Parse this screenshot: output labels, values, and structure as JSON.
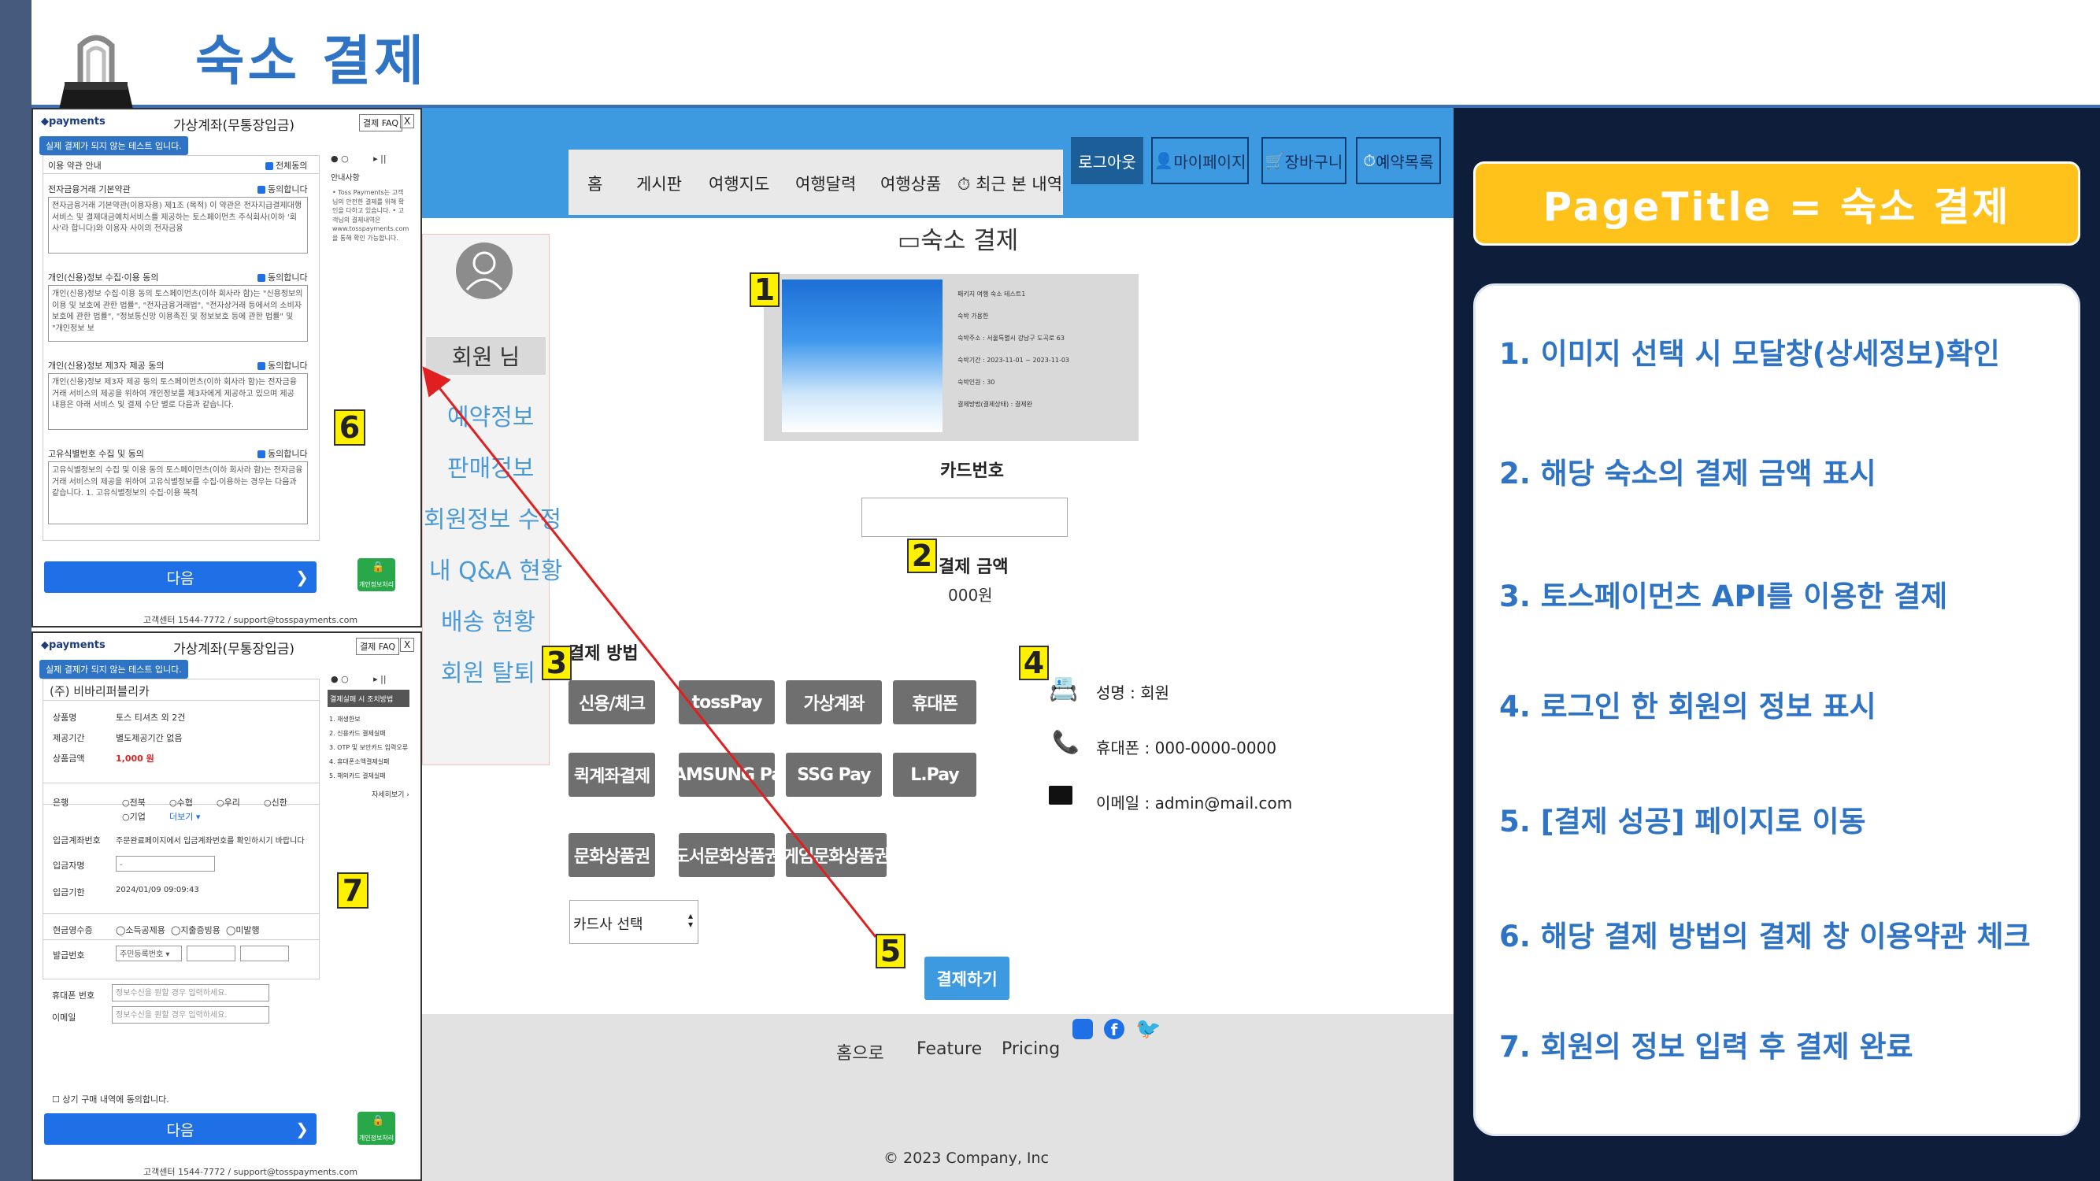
{
  "page_title": "숙소 결제",
  "right_panel": {
    "page_title_label": "PageTitle = 숙소 결제",
    "descriptions": [
      "1. 이미지 선택 시 모달창(상세정보)확인",
      "2. 해당 숙소의 결제 금액 표시",
      "3. 토스페이먼츠 API를 이용한 결제",
      "4. 로그인 한 회원의 정보 표시",
      "5. [결제 성공] 페이지로 이동",
      "6. 해당 결제 방법의 결제 창 이용약관 체크",
      "7. 회원의 정보 입력 후 결제 완료"
    ]
  },
  "popup_top": {
    "logo": "payments",
    "title": "가상계좌(무통장입금)",
    "faq": "결제 FAQ",
    "close": "X",
    "test_notice": "실제 결제가 되지 않는 테스트 입니다.",
    "terms_header": "이용 약관 안내",
    "agree_all": "전체동의",
    "agree": "동의합니다",
    "terms": [
      {
        "title": "전자금융거래 기본약관",
        "text": "전자금융거래 기본약관(이용자용) 제1조 (목적) 이 약관은 전자지급결제대행서비스 및 결제대금예치서비스를 제공하는 토스페이먼츠 주식회사(이하 '회사'라 합니다)와 이용자 사이의 전자금융"
      },
      {
        "title": "개인(신용)정보 수집·이용 동의",
        "text": "개인(신용)정보 수집·이용 동의 토스페이먼츠(이하 회사라 함)는 \"신용정보의 이용 및 보호에 관한 법률\", \"전자금융거래법\", \"전자상거래 등에서의 소비자보호에 관한 법률\", \"정보통신망 이용촉진 및 정보보호 등에 관한 법률\" 및 \"개인정보 보"
      },
      {
        "title": "개인(신용)정보 제3자 제공 동의",
        "text": "개인(신용)정보 제3자 제공 동의 토스페이먼츠(이하 회사라 함)는 전자금융거래 서비스의 제공을 위하여 개인정보를 제3자에게 제공하고 있으며 제공 내용은 아래 서비스 및 결제 수단 별로 다음과 같습니다."
      },
      {
        "title": "고유식별번호 수집 및 동의",
        "text": "고유식별정보의 수집 및 이용 동의 토스페이먼츠(이하 회사라 함)는 전자금융거래 서비스의 제공을 위하여 고유식별정보를 수집·이용하는 경우는 다음과 같습니다. 1. 고유식별정보의 수집·이용 목적"
      }
    ],
    "side_title": "안내사항",
    "side_text": "• Toss Payments는 고객님의 안전한 결제를 위해 확인을 다하고 있습니다. • 고객님의 결제내역은 www.tosspayments.com을 통해 확인 가능합니다.",
    "next": "다음",
    "green_label": "개인정보처리",
    "footer": "고객센터 1544-7772 / support@tosspayments.com"
  },
  "popup_bottom": {
    "logo": "payments",
    "title": "가상계좌(무통장입금)",
    "faq": "결제 FAQ",
    "close": "X",
    "test_notice": "실제 결제가 되지 않는 테스트 입니다.",
    "merchant": "(주) 비바리퍼블리카",
    "rows": [
      {
        "label": "상품명",
        "value": "토스 티셔츠 외 2건"
      },
      {
        "label": "제공기간",
        "value": "별도제공기간 없음"
      },
      {
        "label": "상품금액",
        "value": "1,000 원"
      }
    ],
    "bank_label": "은행",
    "banks": [
      "전북",
      "수협",
      "우리",
      "신한",
      "기업",
      "더보기 ▾"
    ],
    "deposit_label": "입금계좌번호",
    "deposit_text": "주문완료페이지에서 입금계좌번호를 확인하시기 바랍니다",
    "depositor_label": "입금자명",
    "depositor_value": "-",
    "deadline_label": "입금기한",
    "deadline_value": "2024/01/09 09:09:43",
    "receipt_label": "현금영수증",
    "receipt_options": [
      "소득공제용",
      "지출증빙용",
      "미발행"
    ],
    "issue_label": "발급번호",
    "issue_select": "주민등록번호",
    "phone_label": "휴대폰 번호",
    "phone_placeholder": "정보수신을 원할 경우 입력하세요.",
    "email_label": "이메일",
    "email_placeholder": "정보수신을 원할 경우 입력하세요.",
    "consent": "상기 구매 내역에 동의합니다.",
    "side_title": "결제실패 시 조치방법",
    "side_items": [
      "1. 재생한보",
      "2. 신용카드 결제실패",
      "3. OTP 및 보안카드 입력오류",
      "4. 휴대폰소액결제실패",
      "5. 해외카드 결제실패"
    ],
    "side_more": "자세히보기 ›",
    "next": "다음",
    "green_label": "개인정보처리",
    "footer": "고객센터 1544-7772 / support@tosspayments.com"
  },
  "site": {
    "menu": [
      "홈",
      "게시판",
      "여행지도",
      "여행달력",
      "여행상품",
      "최근 본 내역"
    ],
    "logout": "로그아웃",
    "mypage": "마이페이지",
    "cart": "장바구니",
    "reservations": "예약목록",
    "member": "회원 님",
    "side_links": [
      "예약정보",
      "판매정보",
      "회원정보 수정",
      "내 Q&A 현황",
      "배송 현황",
      "회원 탈퇴"
    ],
    "section_title": "숙소 결제",
    "product_info": [
      "패키지 여행 숙소 테스트1",
      "숙박 가용한",
      "숙박주소 : 서울특별시 강남구 도곡로 63",
      "숙박기간 : 2023-11-01 ~ 2023-11-03",
      "숙박인원 : 30",
      "결제방법(결제상태) : 결제완"
    ],
    "card_number_label": "카드번호",
    "amount_label": "결제 금액",
    "amount_value": "000원",
    "payment_method_label": "결제 방법",
    "pay_buttons": [
      "신용/체크",
      "tossPay",
      "가상계좌",
      "휴대폰",
      "퀵계좌결제",
      "SAMSUNG Pay",
      "SSG Pay",
      "L.Pay",
      "문화상품권",
      "도서문화상품권",
      "게임문화상품권"
    ],
    "card_select": "카드사 선택",
    "submit": "결제하기",
    "name_row": "성명 : 회원",
    "phone_row": "휴대폰 : 000-0000-0000",
    "email_row": "이메일 : admin@mail.com",
    "footer_links": [
      "홈으로",
      "Feature",
      "Pricing"
    ],
    "copyright": "© 2023 Company, Inc"
  },
  "markers": [
    "1",
    "2",
    "3",
    "4",
    "5",
    "6",
    "7"
  ],
  "colors": {
    "accent": "#2f74c4",
    "header_blue": "#3d9ae0",
    "marker_yellow": "#fff100",
    "panel_dark": "#0d1d3a",
    "title_yellow": "#fec21a",
    "arrow_red": "#e02020"
  }
}
